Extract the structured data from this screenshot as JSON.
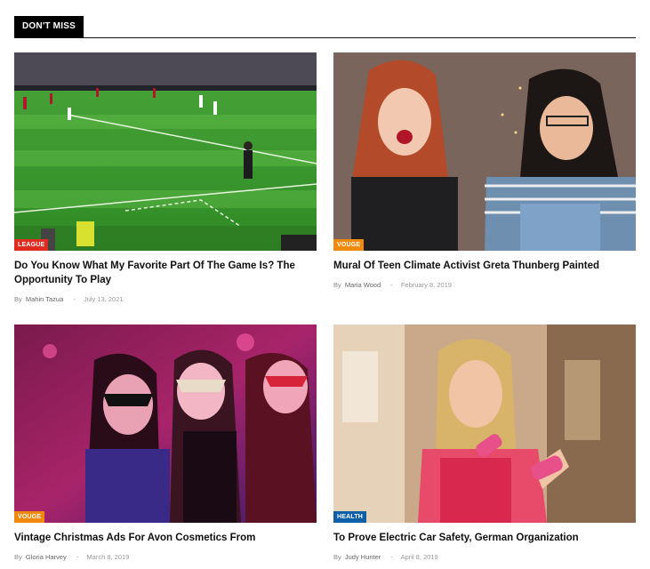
{
  "section": {
    "title": "DON'T MISS"
  },
  "colors": {
    "league": "#e02b20",
    "vouge": "#f08a0c",
    "health": "#0d5fa8"
  },
  "posts": [
    {
      "category": "LEAGUE",
      "category_color": "#e02b20",
      "title": "Do You Know What My Favorite Part Of The Game Is? The Opportunity To Play",
      "by": "By",
      "author": "Mahin Tazua",
      "sep": "-",
      "date": "July 13, 2021"
    },
    {
      "category": "VOUGE",
      "category_color": "#f08a0c",
      "title": "Mural Of Teen Climate Activist Greta Thunberg Painted",
      "by": "By",
      "author": "Maria Wood",
      "sep": "-",
      "date": "February 8, 2019"
    },
    {
      "category": "VOUGE",
      "category_color": "#f08a0c",
      "title": "Vintage Christmas Ads For Avon Cosmetics From",
      "by": "By",
      "author": "Gloria Harvey",
      "sep": "-",
      "date": "March 8, 2019"
    },
    {
      "category": "HEALTH",
      "category_color": "#0d5fa8",
      "title": "To Prove Electric Car Safety, German Organization",
      "by": "By",
      "author": "Judy Hunter",
      "sep": "-",
      "date": "April 8, 2019"
    }
  ]
}
